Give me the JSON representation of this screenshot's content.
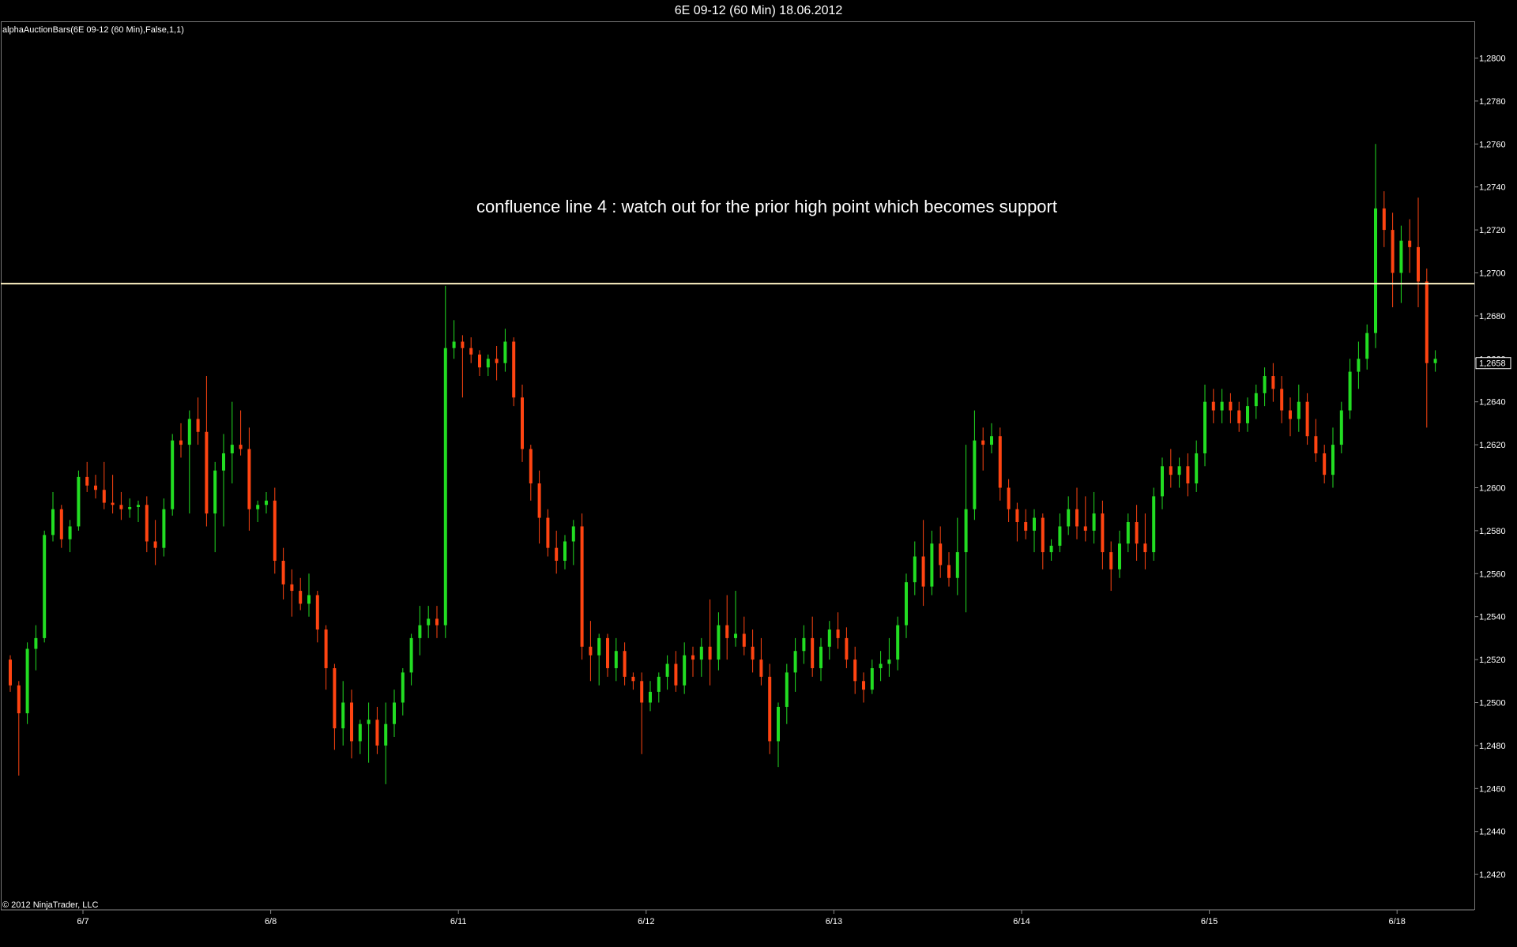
{
  "window": {
    "title": "6E 09-12 (60 Min)  18.06.2012"
  },
  "panel": {
    "indicator_label": "alphaAuctionBars(6E 09-12 (60 Min),False,1,1)",
    "copyright": "© 2012 NinjaTrader, LLC"
  },
  "annotation": {
    "text": "confluence line 4 : watch out for the prior high point which becomes support"
  },
  "colors": {
    "up_bar": "#22dd22",
    "down_bar": "#ff4411",
    "doji_bar": "#ffffff",
    "neutral_bar": "#ffaa22",
    "level_line": "#fff3c4",
    "axis": "#888888"
  },
  "chart_data": {
    "type": "candlestick",
    "y_axis": {
      "range": [
        1.24,
        1.281
      ],
      "ticks": [
        "1,2420",
        "1,2440",
        "1,2460",
        "1,2480",
        "1,2500",
        "1,2520",
        "1,2540",
        "1,2560",
        "1,2580",
        "1,2600",
        "1,2620",
        "1,2640",
        "1,2660",
        "1,2680",
        "1,2700",
        "1,2720",
        "1,2740",
        "1,2760",
        "1,2780",
        "1,2800"
      ],
      "tick_values": [
        1.242,
        1.244,
        1.246,
        1.248,
        1.25,
        1.252,
        1.254,
        1.256,
        1.258,
        1.26,
        1.262,
        1.264,
        1.266,
        1.268,
        1.27,
        1.272,
        1.274,
        1.276,
        1.278,
        1.28
      ]
    },
    "x_axis": {
      "labels": [
        "6/7",
        "6/8",
        "6/11",
        "6/12",
        "6/13",
        "6/14",
        "6/15",
        "6/18"
      ],
      "label_bar_index": [
        0,
        22,
        44,
        66,
        88,
        110,
        132,
        154
      ]
    },
    "current_price": {
      "value": 1.2658,
      "label": "1,2658"
    },
    "horizontal_line": {
      "value": 1.2695
    },
    "series": [
      {
        "bars": [
          [
            1.252,
            1.2522,
            1.2505,
            1.2508
          ],
          [
            1.2508,
            1.251,
            1.2466,
            1.2495
          ],
          [
            1.2495,
            1.2528,
            1.249,
            1.2525
          ],
          [
            1.2525,
            1.2536,
            1.2515,
            1.253
          ],
          [
            1.253,
            1.258,
            1.2528,
            1.2578
          ],
          [
            1.2578,
            1.2598,
            1.2575,
            1.259
          ],
          [
            1.259,
            1.2592,
            1.2572,
            1.2576
          ],
          [
            1.2576,
            1.2585,
            1.257,
            1.2582
          ],
          [
            1.2582,
            1.2608,
            1.258,
            1.2605
          ],
          [
            1.2605,
            1.2612,
            1.2598,
            1.2601
          ],
          [
            1.2601,
            1.2606,
            1.2595,
            1.2599
          ],
          [
            1.2599,
            1.2612,
            1.259,
            1.2593
          ],
          [
            1.2593,
            1.2606,
            1.2588,
            1.2592
          ],
          [
            1.2592,
            1.2598,
            1.2585,
            1.259
          ],
          [
            1.259,
            1.2595,
            1.2586,
            1.2591
          ],
          [
            1.2591,
            1.2594,
            1.2584,
            1.2592
          ],
          [
            1.2592,
            1.2596,
            1.257,
            1.2575
          ],
          [
            1.2575,
            1.2585,
            1.2564,
            1.2572
          ],
          [
            1.2572,
            1.2595,
            1.2568,
            1.259
          ],
          [
            1.259,
            1.2625,
            1.2587,
            1.2622
          ],
          [
            1.2622,
            1.263,
            1.2614,
            1.262
          ],
          [
            1.262,
            1.2636,
            1.2588,
            1.2632
          ],
          [
            1.2632,
            1.2642,
            1.262,
            1.2626
          ],
          [
            1.2626,
            1.2652,
            1.2582,
            1.2588
          ],
          [
            1.2588,
            1.2612,
            1.257,
            1.2608
          ],
          [
            1.2608,
            1.2625,
            1.2582,
            1.2616
          ],
          [
            1.2616,
            1.264,
            1.2602,
            1.262
          ],
          [
            1.262,
            1.2636,
            1.2615,
            1.2618
          ],
          [
            1.2618,
            1.2628,
            1.258,
            1.259
          ],
          [
            1.259,
            1.2594,
            1.2584,
            1.2592
          ],
          [
            1.2592,
            1.2598,
            1.2588,
            1.2594
          ],
          [
            1.2594,
            1.26,
            1.256,
            1.2566
          ],
          [
            1.2566,
            1.2572,
            1.2548,
            1.2555
          ],
          [
            1.2555,
            1.2562,
            1.254,
            1.2552
          ],
          [
            1.2552,
            1.2558,
            1.2543,
            1.2546
          ],
          [
            1.2546,
            1.256,
            1.254,
            1.255
          ],
          [
            1.255,
            1.2552,
            1.2528,
            1.2534
          ],
          [
            1.2534,
            1.2536,
            1.2506,
            1.2516
          ],
          [
            1.2516,
            1.2518,
            1.2478,
            1.2488
          ],
          [
            1.2488,
            1.251,
            1.248,
            1.25
          ],
          [
            1.25,
            1.2506,
            1.2474,
            1.2482
          ],
          [
            1.2482,
            1.2492,
            1.2476,
            1.249
          ],
          [
            1.249,
            1.25,
            1.2472,
            1.2492
          ],
          [
            1.2492,
            1.2498,
            1.2476,
            1.248
          ],
          [
            1.248,
            1.25,
            1.2462,
            1.249
          ],
          [
            1.249,
            1.2506,
            1.2484,
            1.25
          ],
          [
            1.25,
            1.2516,
            1.2494,
            1.2514
          ],
          [
            1.2514,
            1.2532,
            1.2508,
            1.253
          ],
          [
            1.253,
            1.2545,
            1.2522,
            1.2536
          ],
          [
            1.2536,
            1.2545,
            1.253,
            1.2539
          ],
          [
            1.2539,
            1.2545,
            1.253,
            1.2536
          ],
          [
            1.2536,
            1.2694,
            1.253,
            1.2665
          ],
          [
            1.2665,
            1.2678,
            1.266,
            1.2668
          ],
          [
            1.2668,
            1.2671,
            1.2642,
            1.2665
          ],
          [
            1.2665,
            1.267,
            1.2658,
            1.2662
          ],
          [
            1.2662,
            1.2664,
            1.2652,
            1.2656
          ],
          [
            1.2656,
            1.2662,
            1.2652,
            1.266
          ],
          [
            1.266,
            1.2666,
            1.265,
            1.2658
          ],
          [
            1.2658,
            1.2674,
            1.2654,
            1.2668
          ],
          [
            1.2668,
            1.267,
            1.2638,
            1.2642
          ],
          [
            1.2642,
            1.2648,
            1.2612,
            1.2618
          ],
          [
            1.2618,
            1.262,
            1.2594,
            1.2602
          ],
          [
            1.2602,
            1.2608,
            1.2574,
            1.2586
          ],
          [
            1.2586,
            1.259,
            1.2568,
            1.2572
          ],
          [
            1.2572,
            1.258,
            1.256,
            1.2566
          ],
          [
            1.2566,
            1.2578,
            1.2562,
            1.2575
          ],
          [
            1.2575,
            1.2585,
            1.2564,
            1.2582
          ],
          [
            1.2582,
            1.2588,
            1.252,
            1.2526
          ],
          [
            1.2526,
            1.2538,
            1.251,
            1.2522
          ],
          [
            1.2522,
            1.2532,
            1.2508,
            1.253
          ],
          [
            1.253,
            1.2532,
            1.2512,
            1.2516
          ],
          [
            1.2516,
            1.253,
            1.251,
            1.2524
          ],
          [
            1.2524,
            1.2528,
            1.2508,
            1.2512
          ],
          [
            1.2512,
            1.2514,
            1.2506,
            1.251
          ],
          [
            1.251,
            1.2514,
            1.2476,
            1.25
          ],
          [
            1.25,
            1.251,
            1.2496,
            1.2505
          ],
          [
            1.2505,
            1.2514,
            1.25,
            1.2512
          ],
          [
            1.2512,
            1.2522,
            1.2506,
            1.2518
          ],
          [
            1.2518,
            1.2524,
            1.2505,
            1.2508
          ],
          [
            1.2508,
            1.2528,
            1.2504,
            1.2522
          ],
          [
            1.2522,
            1.2526,
            1.2512,
            1.252
          ],
          [
            1.252,
            1.253,
            1.2512,
            1.2526
          ],
          [
            1.2526,
            1.2548,
            1.2508,
            1.252
          ],
          [
            1.252,
            1.2542,
            1.2515,
            1.2536
          ],
          [
            1.2536,
            1.255,
            1.252,
            1.253
          ],
          [
            1.253,
            1.2552,
            1.2526,
            1.2532
          ],
          [
            1.2532,
            1.254,
            1.2522,
            1.2526
          ],
          [
            1.2526,
            1.2534,
            1.2514,
            1.252
          ],
          [
            1.252,
            1.253,
            1.2508,
            1.2512
          ],
          [
            1.2512,
            1.2518,
            1.2476,
            1.2482
          ],
          [
            1.2482,
            1.25,
            1.247,
            1.2498
          ],
          [
            1.2498,
            1.2518,
            1.249,
            1.2514
          ],
          [
            1.2514,
            1.253,
            1.2505,
            1.2524
          ],
          [
            1.2524,
            1.2536,
            1.2518,
            1.253
          ],
          [
            1.253,
            1.254,
            1.2512,
            1.2516
          ],
          [
            1.2516,
            1.253,
            1.251,
            1.2526
          ],
          [
            1.2526,
            1.2538,
            1.252,
            1.2534
          ],
          [
            1.2534,
            1.2542,
            1.2525,
            1.253
          ],
          [
            1.253,
            1.2535,
            1.2516,
            1.252
          ],
          [
            1.252,
            1.2526,
            1.2504,
            1.251
          ],
          [
            1.251,
            1.2514,
            1.25,
            1.2506
          ],
          [
            1.2506,
            1.252,
            1.2504,
            1.2516
          ],
          [
            1.2516,
            1.2524,
            1.251,
            1.2518
          ],
          [
            1.2518,
            1.253,
            1.2512,
            1.252
          ],
          [
            1.252,
            1.254,
            1.2515,
            1.2536
          ],
          [
            1.2536,
            1.256,
            1.253,
            1.2556
          ],
          [
            1.2556,
            1.2575,
            1.255,
            1.2568
          ],
          [
            1.2568,
            1.2585,
            1.2545,
            1.2554
          ],
          [
            1.2554,
            1.258,
            1.255,
            1.2574
          ],
          [
            1.2574,
            1.2582,
            1.2558,
            1.2564
          ],
          [
            1.2564,
            1.257,
            1.2554,
            1.2558
          ],
          [
            1.2558,
            1.2586,
            1.255,
            1.257
          ],
          [
            1.257,
            1.262,
            1.2542,
            1.259
          ],
          [
            1.259,
            1.2636,
            1.2585,
            1.2622
          ],
          [
            1.2622,
            1.2628,
            1.2608,
            1.262
          ],
          [
            1.262,
            1.263,
            1.2616,
            1.2624
          ],
          [
            1.2624,
            1.2628,
            1.2594,
            1.26
          ],
          [
            1.26,
            1.2604,
            1.2584,
            1.259
          ],
          [
            1.259,
            1.2593,
            1.2575,
            1.2584
          ],
          [
            1.2584,
            1.259,
            1.2576,
            1.258
          ],
          [
            1.258,
            1.259,
            1.257,
            1.2586
          ],
          [
            1.2586,
            1.2588,
            1.2562,
            1.257
          ],
          [
            1.257,
            1.2576,
            1.2566,
            1.2573
          ],
          [
            1.2573,
            1.2588,
            1.257,
            1.2582
          ],
          [
            1.2582,
            1.2596,
            1.2578,
            1.259
          ],
          [
            1.259,
            1.26,
            1.2576,
            1.2582
          ],
          [
            1.2582,
            1.2596,
            1.2575,
            1.258
          ],
          [
            1.258,
            1.2598,
            1.2574,
            1.2588
          ],
          [
            1.2588,
            1.2594,
            1.2562,
            1.257
          ],
          [
            1.257,
            1.2575,
            1.2552,
            1.2562
          ],
          [
            1.2562,
            1.258,
            1.2558,
            1.2574
          ],
          [
            1.2574,
            1.2588,
            1.257,
            1.2584
          ],
          [
            1.2584,
            1.2592,
            1.2566,
            1.2574
          ],
          [
            1.2574,
            1.2588,
            1.2562,
            1.257
          ],
          [
            1.257,
            1.26,
            1.2566,
            1.2596
          ],
          [
            1.2596,
            1.2614,
            1.259,
            1.261
          ],
          [
            1.261,
            1.2618,
            1.26,
            1.2606
          ],
          [
            1.2606,
            1.2614,
            1.26,
            1.261
          ],
          [
            1.261,
            1.2616,
            1.2596,
            1.2602
          ],
          [
            1.2602,
            1.2622,
            1.2598,
            1.2616
          ],
          [
            1.2616,
            1.2648,
            1.261,
            1.264
          ],
          [
            1.264,
            1.2646,
            1.263,
            1.2636
          ],
          [
            1.2636,
            1.2646,
            1.263,
            1.264
          ],
          [
            1.264,
            1.2644,
            1.263,
            1.2636
          ],
          [
            1.2636,
            1.264,
            1.2626,
            1.263
          ],
          [
            1.263,
            1.2642,
            1.2626,
            1.2638
          ],
          [
            1.2638,
            1.2648,
            1.2632,
            1.2644
          ],
          [
            1.2644,
            1.2656,
            1.2638,
            1.2652
          ],
          [
            1.2652,
            1.2658,
            1.264,
            1.2646
          ],
          [
            1.2646,
            1.2652,
            1.263,
            1.2636
          ],
          [
            1.2636,
            1.2642,
            1.2624,
            1.2632
          ],
          [
            1.2632,
            1.2648,
            1.2626,
            1.264
          ],
          [
            1.264,
            1.2644,
            1.262,
            1.2624
          ],
          [
            1.2624,
            1.2632,
            1.2612,
            1.2616
          ],
          [
            1.2616,
            1.262,
            1.2602,
            1.2606
          ],
          [
            1.2606,
            1.2628,
            1.26,
            1.262
          ],
          [
            1.262,
            1.264,
            1.2616,
            1.2636
          ],
          [
            1.2636,
            1.266,
            1.2632,
            1.2654
          ],
          [
            1.2654,
            1.2668,
            1.2646,
            1.266
          ],
          [
            1.266,
            1.2676,
            1.2655,
            1.2672
          ],
          [
            1.2672,
            1.276,
            1.2665,
            1.273
          ],
          [
            1.273,
            1.2738,
            1.2712,
            1.272
          ],
          [
            1.272,
            1.2728,
            1.2684,
            1.27
          ],
          [
            1.27,
            1.2722,
            1.2686,
            1.2715
          ],
          [
            1.2715,
            1.2725,
            1.27,
            1.2712
          ],
          [
            1.2712,
            1.2735,
            1.2684,
            1.2696
          ],
          [
            1.2696,
            1.2702,
            1.2628,
            1.2658
          ],
          [
            1.2658,
            1.2664,
            1.2654,
            1.266
          ]
        ]
      }
    ]
  }
}
